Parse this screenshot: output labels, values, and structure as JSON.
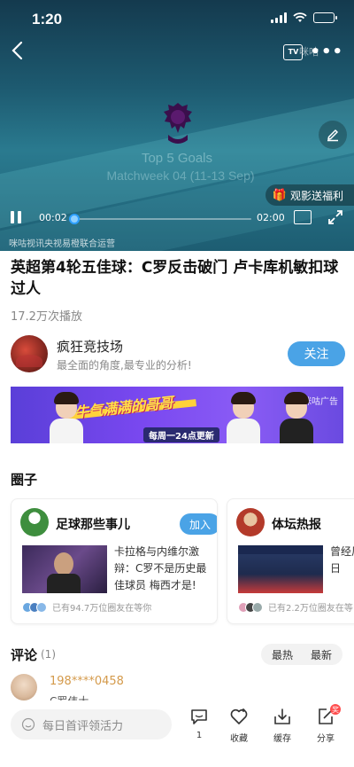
{
  "status_bar": {
    "time": "1:20"
  },
  "video": {
    "watermark": "咪咕",
    "tv_label": "TV",
    "title_line1": "Top 5 Goals",
    "title_line2": "Matchweek 04 (11-13 Sep)",
    "promo": "观影送福利",
    "current_time": "00:02",
    "total_time": "02:00",
    "progress": 0.02,
    "operator": "咪咕视讯央视易橙联合运营"
  },
  "article": {
    "headline": "英超第4轮五佳球：C罗反击破门 卢卡库机敏扣球过人",
    "play_count": "17.2万次播放"
  },
  "author": {
    "name": "疯狂竞技场",
    "desc": "最全面的角度,最专业的分析!",
    "follow_label": "关注"
  },
  "ad": {
    "slogan": "牛气满满的哥哥",
    "sub": "每周一24点更新",
    "tag": "咪咕广告"
  },
  "circles": {
    "title": "圈子",
    "items": [
      {
        "name": "足球那些事儿",
        "join_label": "加入",
        "post": "卡拉格与内维尔激辩：C罗不是历史最佳球员 梅西才是!",
        "members": "已有94.7万位圈友在等你"
      },
      {
        "name": "体坛热报",
        "post": "曾经风 国足抗 足vs日",
        "members": "已有2.2万位圈友在等"
      }
    ]
  },
  "comments": {
    "title": "评论",
    "count": "(1)",
    "sort": [
      "最热",
      "最新"
    ],
    "first_user": "198****0458",
    "first_peek": "C罗伟大"
  },
  "bottom_bar": {
    "input_placeholder": "每日首评领活力",
    "comment_count": "1",
    "collect": "收藏",
    "cache": "缓存",
    "share": "分享",
    "share_badge": "奖"
  },
  "colors": {
    "accent": "#4aa3e6",
    "progress": "#2ea0ff",
    "username": "#d49a4b"
  }
}
